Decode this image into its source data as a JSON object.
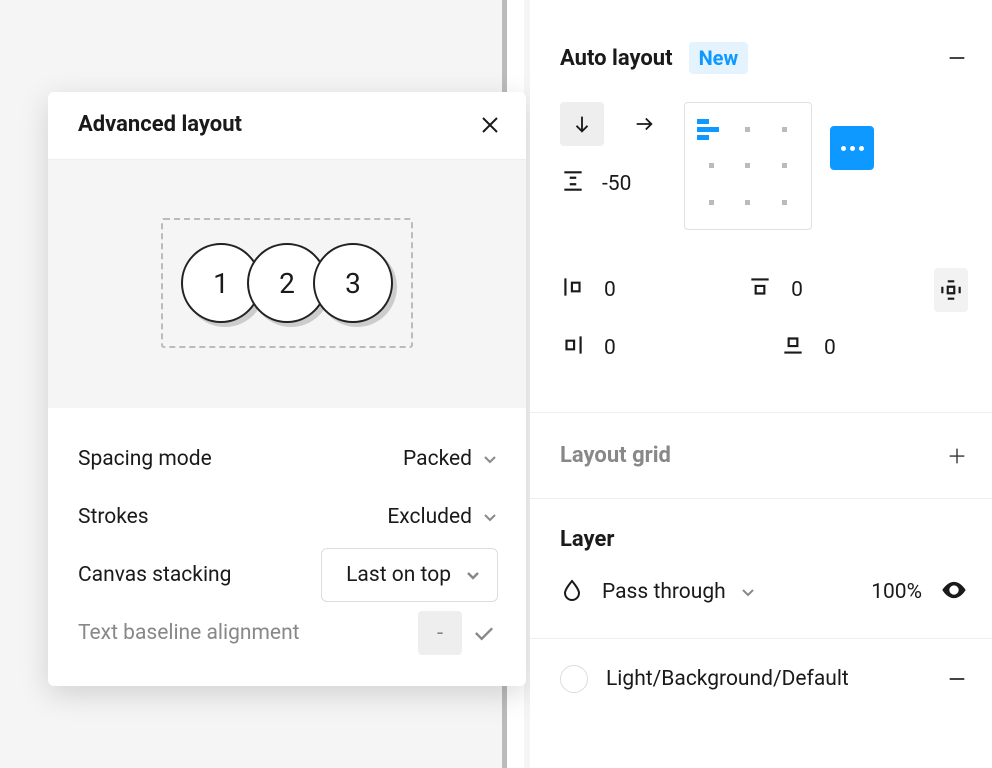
{
  "popover": {
    "title": "Advanced layout",
    "preview_chars": [
      "1",
      "2",
      "3"
    ],
    "spacing_mode_label": "Spacing mode",
    "spacing_mode_value": "Packed",
    "strokes_label": "Strokes",
    "strokes_value": "Excluded",
    "canvas_stacking_label": "Canvas stacking",
    "canvas_stacking_value": "Last on top",
    "baseline_label": "Text baseline alignment",
    "baseline_toggle_char": "-"
  },
  "autolayout": {
    "title": "Auto layout",
    "badge": "New",
    "spacing_value": "-50",
    "padding_top": "0",
    "padding_left": "0",
    "padding_right": "0",
    "padding_bottom": "0"
  },
  "layout_grid": {
    "title": "Layout grid"
  },
  "layer": {
    "title": "Layer",
    "blend_mode": "Pass through",
    "opacity": "100%"
  },
  "fill": {
    "name": "Light/Background/Default"
  }
}
